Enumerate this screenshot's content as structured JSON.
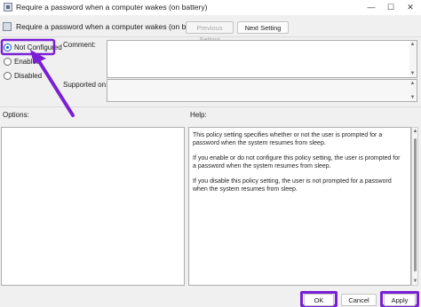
{
  "window": {
    "title": "Require a password when a computer wakes (on battery)",
    "minimize": "—",
    "maximize": "☐",
    "close": "✕"
  },
  "header": {
    "title": "Require a password when a computer wakes (on battery)",
    "previous_setting": "Previous Setting",
    "next_setting": "Next Setting"
  },
  "state": {
    "options": [
      "Not Configured",
      "Enabled",
      "Disabled"
    ],
    "selected": "Not Configured"
  },
  "fields": {
    "comment_label": "Comment:",
    "supported_label": "Supported on:"
  },
  "panes": {
    "options_label": "Options:",
    "help_label": "Help:"
  },
  "help": {
    "paragraphs": [
      "This policy setting specifies whether or not the user is prompted for a password when the system resumes from sleep.",
      "If you enable or do not configure this policy setting, the user is prompted for a password when the system resumes from sleep.",
      "If you disable this policy setting, the user is not prompted for a password when the system resumes from sleep."
    ]
  },
  "footer": {
    "ok": "OK",
    "cancel": "Cancel",
    "apply": "Apply"
  },
  "colors": {
    "highlight": "#7a1fd6",
    "radio_accent": "#0a5fc4"
  }
}
